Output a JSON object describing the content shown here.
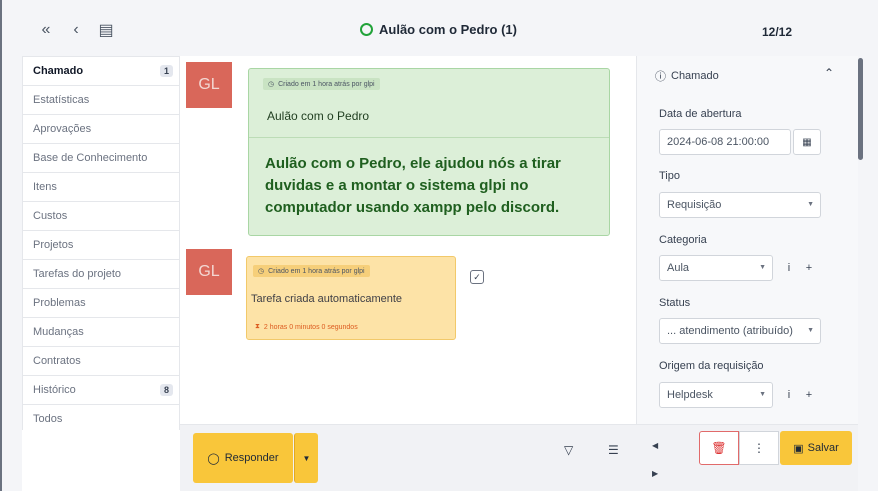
{
  "header": {
    "icons": [
      "double-chevron-left-icon",
      "chevron-left-icon",
      "list-icon"
    ],
    "title": "Aulão com o Pedro (1)",
    "counter": "12/12"
  },
  "nav": {
    "items": [
      {
        "label": "Chamado",
        "badge": "1"
      },
      {
        "label": "Estatísticas",
        "badge": ""
      },
      {
        "label": "Aprovações",
        "badge": ""
      },
      {
        "label": "Base de Conhecimento",
        "badge": ""
      },
      {
        "label": "Itens",
        "badge": ""
      },
      {
        "label": "Custos",
        "badge": ""
      },
      {
        "label": "Projetos",
        "badge": ""
      },
      {
        "label": "Tarefas do projeto",
        "badge": ""
      },
      {
        "label": "Problemas",
        "badge": ""
      },
      {
        "label": "Mudanças",
        "badge": ""
      },
      {
        "label": "Contratos",
        "badge": ""
      },
      {
        "label": "Histórico",
        "badge": "8"
      },
      {
        "label": "Todos",
        "badge": ""
      }
    ]
  },
  "timeline": {
    "item1": {
      "avatar": "GL",
      "meta": "Criado em  1 hora atrás por  glpi",
      "title": "Aulão com o Pedro",
      "body": "Aulão com o Pedro, ele ajudou nós a tirar duvidas e a montar o sistema glpi no computador usando xampp pelo discord."
    },
    "item2": {
      "avatar": "GL",
      "meta": "Criado em  1 hora atrás por  glpi",
      "text": "Tarefa criada automaticamente",
      "duration": "2 horas 0 minutos 0 segundos"
    }
  },
  "panel": {
    "heading": "Chamado",
    "opening_date_label": "Data de abertura",
    "opening_date_value": "2024-06-08 21:00:00",
    "type_label": "Tipo",
    "type_value": "Requisição",
    "category_label": "Categoria",
    "category_value": "Aula",
    "status_label": "Status",
    "status_value": "... atendimento (atribuído)",
    "origin_label": "Origem da requisição",
    "origin_value": "Helpdesk"
  },
  "footer": {
    "reply_label": "Responder",
    "save_label": "Salvar"
  },
  "colors": {
    "green_bubble": "#dcefd8",
    "yellow_bubble": "#fde3a7",
    "accent": "#f9c63a",
    "avatar": "#d9675a"
  }
}
